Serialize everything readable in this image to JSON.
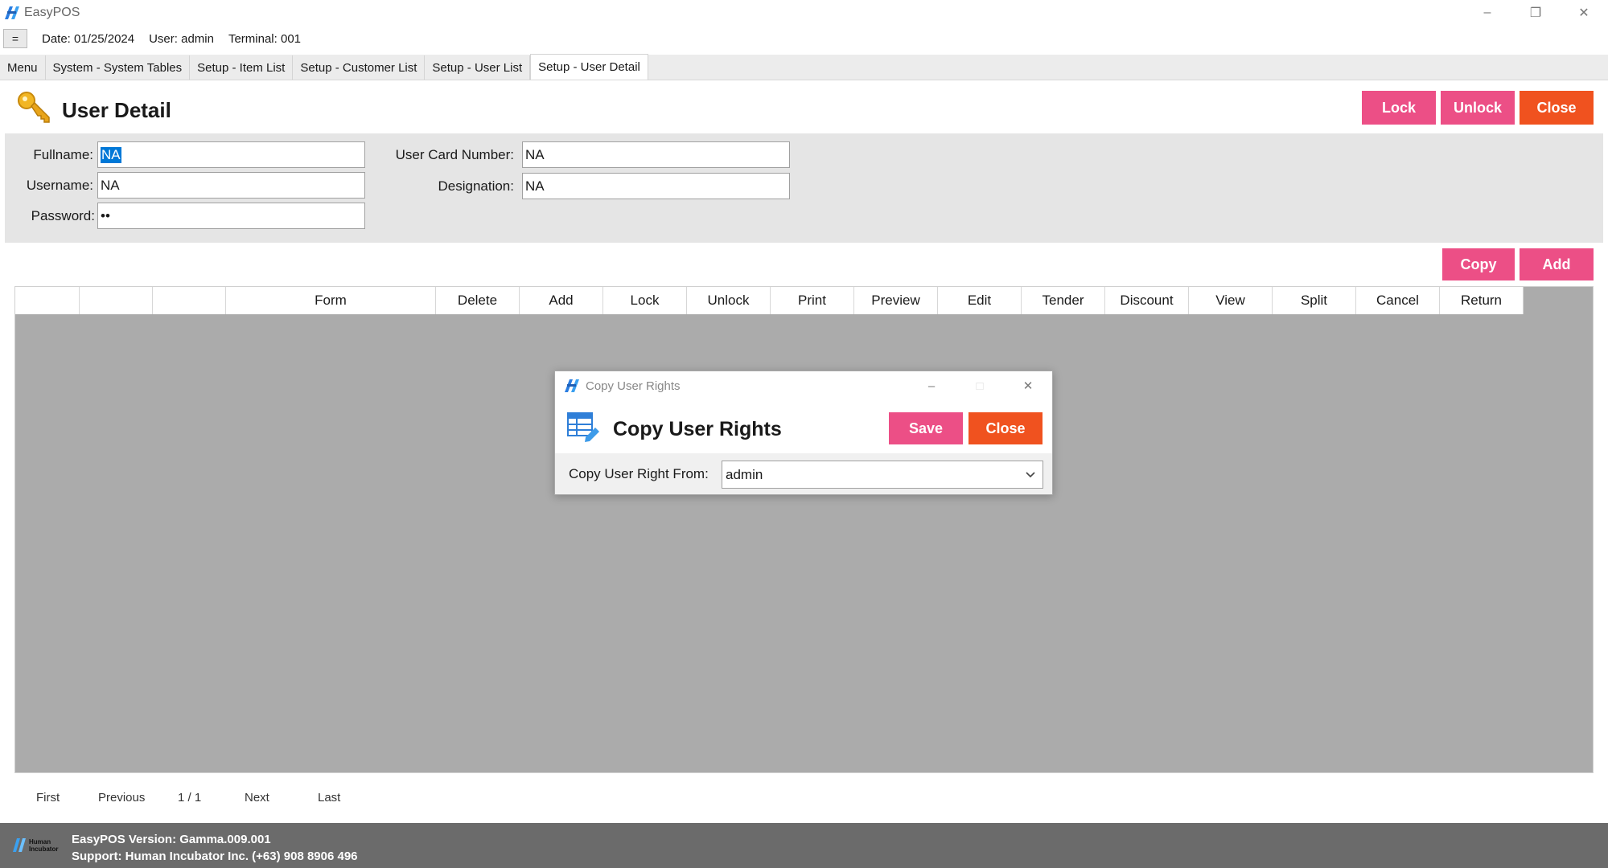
{
  "app": {
    "title": "EasyPOS",
    "date": "Date: 01/25/2024",
    "user": "User: admin",
    "terminal": "Terminal: 001",
    "menu_toggle": "="
  },
  "tabs": [
    {
      "label": "Menu"
    },
    {
      "label": "System - System Tables"
    },
    {
      "label": "Setup - Item List"
    },
    {
      "label": "Setup - Customer List"
    },
    {
      "label": "Setup - User List"
    },
    {
      "label": "Setup - User Detail",
      "active": true
    }
  ],
  "header": {
    "title": "User Detail",
    "lock": "Lock",
    "unlock": "Unlock",
    "close": "Close"
  },
  "form": {
    "fullname_label": "Fullname:",
    "fullname_value": "NA",
    "username_label": "Username:",
    "username_value": "NA",
    "password_label": "Password:",
    "password_value": "••",
    "card_label": "User Card Number:",
    "card_value": "NA",
    "designation_label": "Designation:",
    "designation_value": "NA"
  },
  "grid_actions": {
    "copy": "Copy",
    "add": "Add"
  },
  "grid": {
    "columns": [
      "",
      "",
      "",
      "Form",
      "Delete",
      "Add",
      "Lock",
      "Unlock",
      "Print",
      "Preview",
      "Edit",
      "Tender",
      "Discount",
      "View",
      "Split",
      "Cancel",
      "Return"
    ]
  },
  "pager": {
    "first": "First",
    "previous": "Previous",
    "page": "1 / 1",
    "next": "Next",
    "last": "Last"
  },
  "footer": {
    "version": "EasyPOS Version: Gamma.009.001",
    "support": "Support: Human Incubator Inc. (+63) 908 8906 496",
    "logo_text": "Human Incubator"
  },
  "dialog": {
    "window_title": "Copy User Rights",
    "heading": "Copy User Rights",
    "save": "Save",
    "close": "Close",
    "copy_from_label": "Copy User Right From:",
    "copy_from_value": "admin"
  },
  "colors": {
    "pink": "#ec4f86",
    "orange": "#f0521f",
    "grid_bg": "#ababab",
    "footer_bg": "#6b6b6b"
  }
}
